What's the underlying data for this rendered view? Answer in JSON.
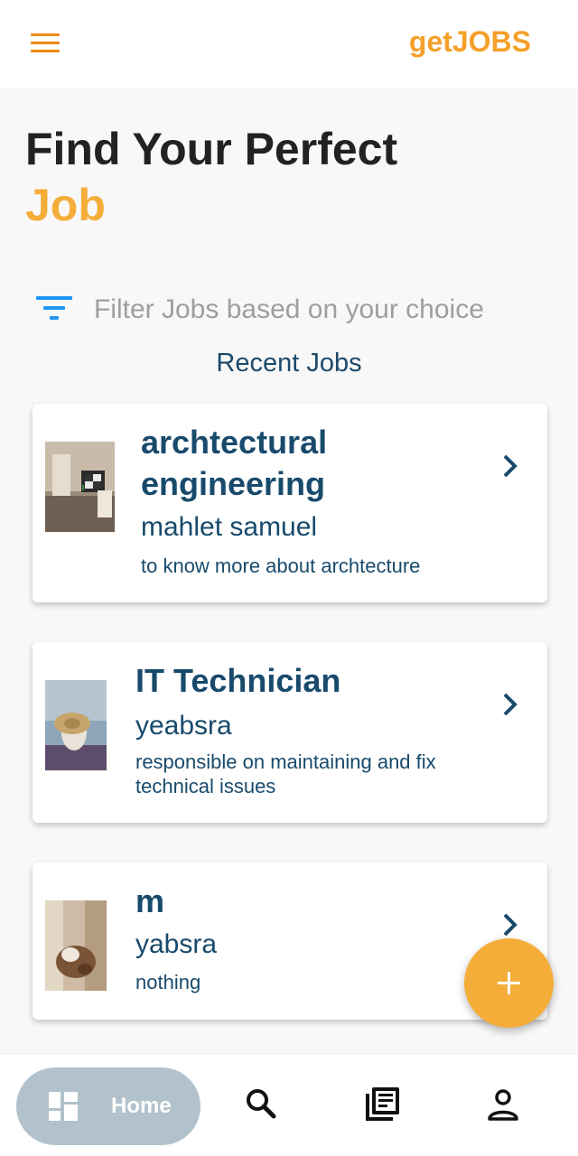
{
  "app": {
    "brand": "getJOBS",
    "accent_color": "#f5ad3a",
    "primary_text_color": "#184a6c"
  },
  "header": {
    "menu_icon": "menu-icon"
  },
  "hero": {
    "title": "Find Your Perfect",
    "accent": "Job"
  },
  "filter": {
    "icon": "filter-icon",
    "placeholder": "Filter Jobs based on your choice"
  },
  "recent": {
    "title": "Recent Jobs",
    "jobs": [
      {
        "title": "archtectural engineering",
        "company": "mahlet samuel",
        "description": "to know more about archtecture"
      },
      {
        "title": "IT Technician",
        "company": "yeabsra",
        "description": "responsible on maintaining and fix technical issues"
      },
      {
        "title": "m",
        "company": "yabsra",
        "description": "nothing"
      }
    ]
  },
  "fab": {
    "icon": "plus-icon"
  },
  "bottom_nav": {
    "home_label": "Home",
    "items": [
      "home-icon",
      "search-icon",
      "library-icon",
      "person-icon"
    ]
  }
}
